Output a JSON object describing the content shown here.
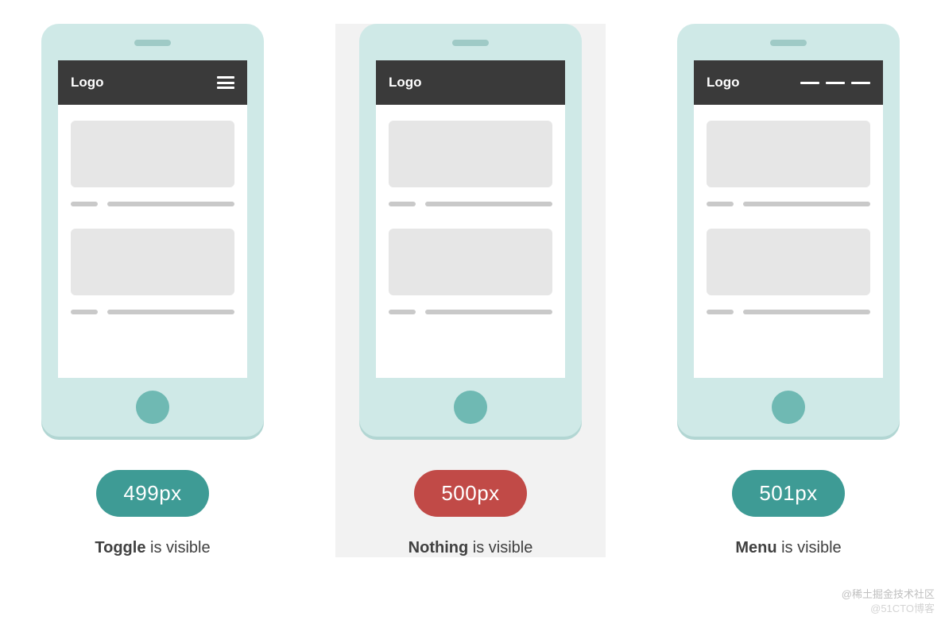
{
  "phones": [
    {
      "logo": "Logo",
      "nav_variant": "toggle",
      "pill_color": "teal",
      "pill_label": "499px",
      "caption_bold": "Toggle",
      "caption_rest": " is visible",
      "highlight": false
    },
    {
      "logo": "Logo",
      "nav_variant": "none",
      "pill_color": "red",
      "pill_label": "500px",
      "caption_bold": "Nothing",
      "caption_rest": " is visible",
      "highlight": true
    },
    {
      "logo": "Logo",
      "nav_variant": "menu",
      "pill_color": "teal",
      "pill_label": "501px",
      "caption_bold": "Menu",
      "caption_rest": " is visible",
      "highlight": false
    }
  ],
  "watermarks": {
    "top": "@稀土掘金技术社区",
    "bottom": "@51CTO博客"
  }
}
